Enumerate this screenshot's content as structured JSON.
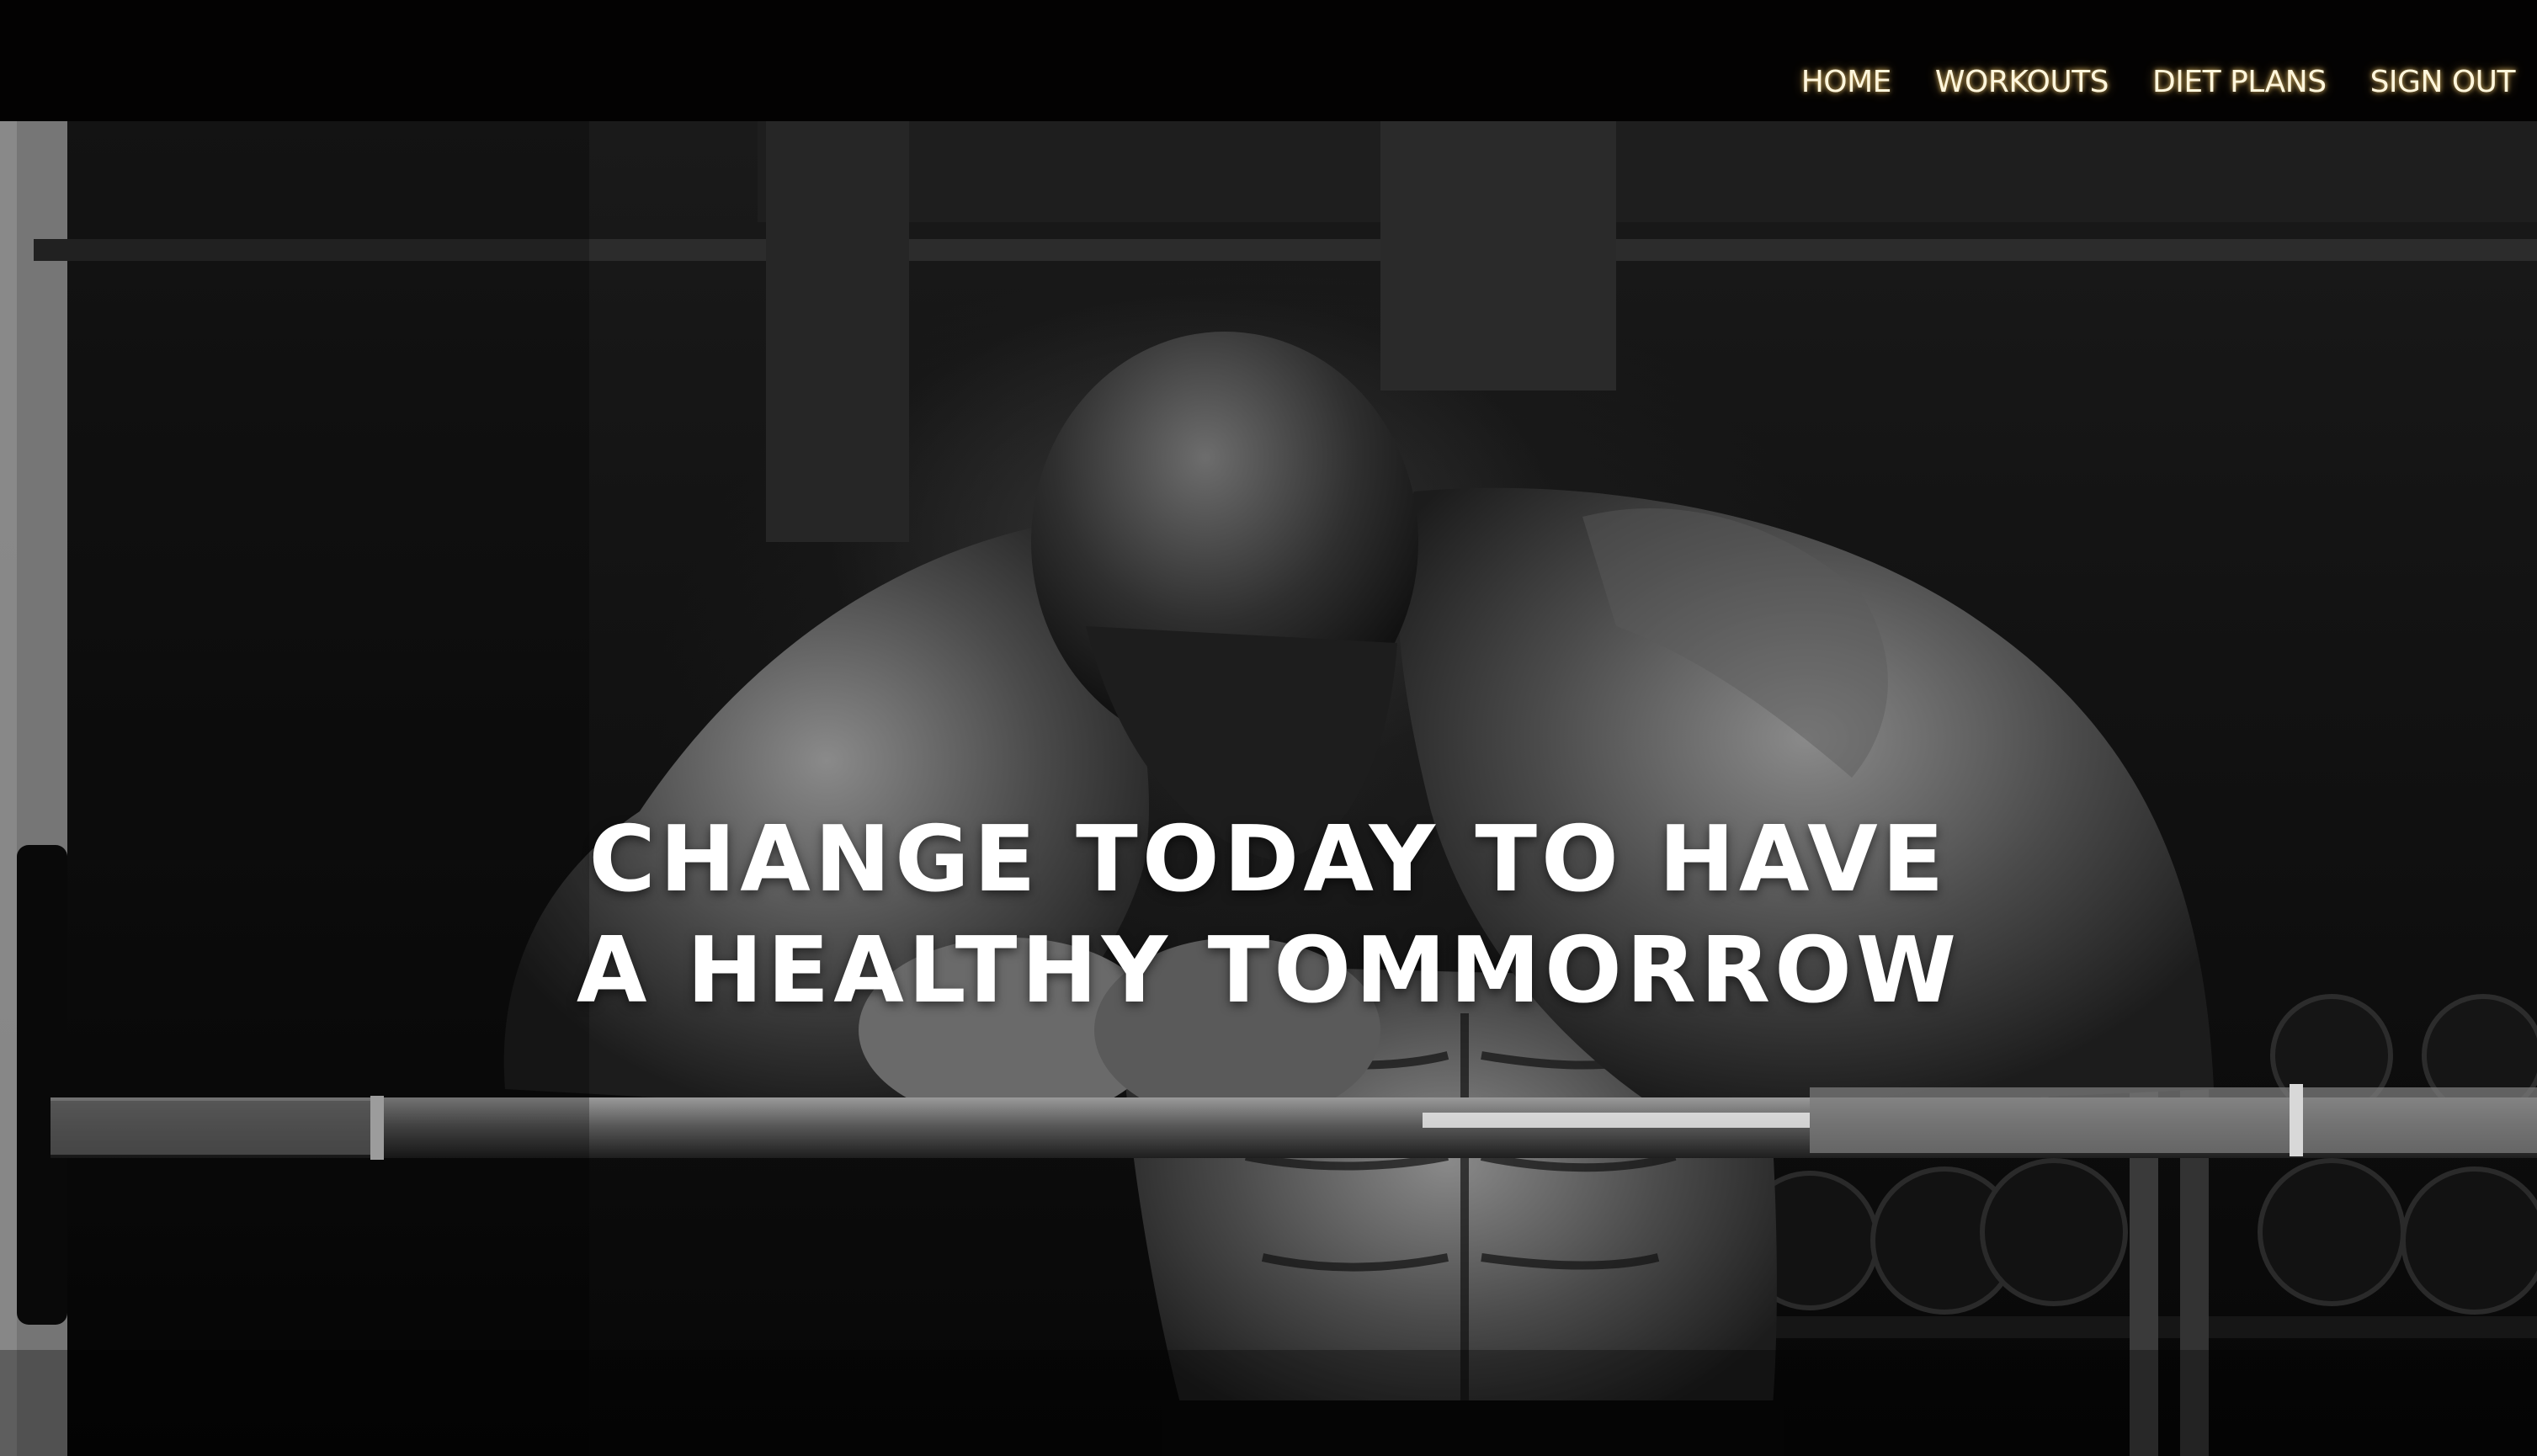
{
  "nav": {
    "items": [
      {
        "label": "HOME"
      },
      {
        "label": "WORKOUTS"
      },
      {
        "label": "DIET PLANS"
      },
      {
        "label": "SIGN OUT"
      }
    ]
  },
  "hero": {
    "headline_line1": "CHANGE TODAY TO HAVE",
    "headline_line2": "A HEALTHY TOMMORROW",
    "image_description_icon": "athlete-leaning-on-barbell-photo"
  },
  "colors": {
    "navbar_bg": "#030202",
    "nav_text": "#fff6dc",
    "nav_glow": "#ffd678",
    "headline_text": "#ffffff"
  }
}
